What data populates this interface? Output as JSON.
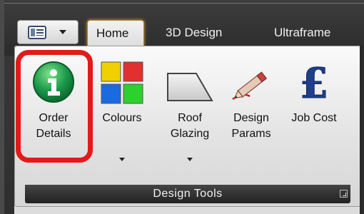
{
  "quick_access": {
    "icon": "ribbon-menu-icon",
    "dropdown_icon": "chevron-down-icon"
  },
  "tabs": [
    {
      "label": "Home",
      "active": true
    },
    {
      "label": "3D Design",
      "active": false
    },
    {
      "label": "Ultraframe",
      "active": false
    }
  ],
  "ribbon": {
    "group_label": "Design Tools",
    "launcher_icon": "dialog-launcher-icon",
    "buttons": [
      {
        "label": "Order\nDetails",
        "icon": "info-icon",
        "has_dropdown": false,
        "highlighted": true
      },
      {
        "label": "Colours",
        "icon": "colour-palette-icon",
        "has_dropdown": true
      },
      {
        "label": "Roof\nGlazing",
        "icon": "roof-glazing-icon",
        "has_dropdown": true
      },
      {
        "label": "Design\nParams",
        "icon": "pencil-icon",
        "has_dropdown": false
      },
      {
        "label": "Job Cost",
        "icon": "pound-sign-icon",
        "has_dropdown": false
      }
    ]
  },
  "colors": {
    "highlight": "#e21a1a",
    "active_tab_border": "#e0a030",
    "info_icon": "#1b9a4a",
    "pound_icon": "#1f3f8a"
  }
}
